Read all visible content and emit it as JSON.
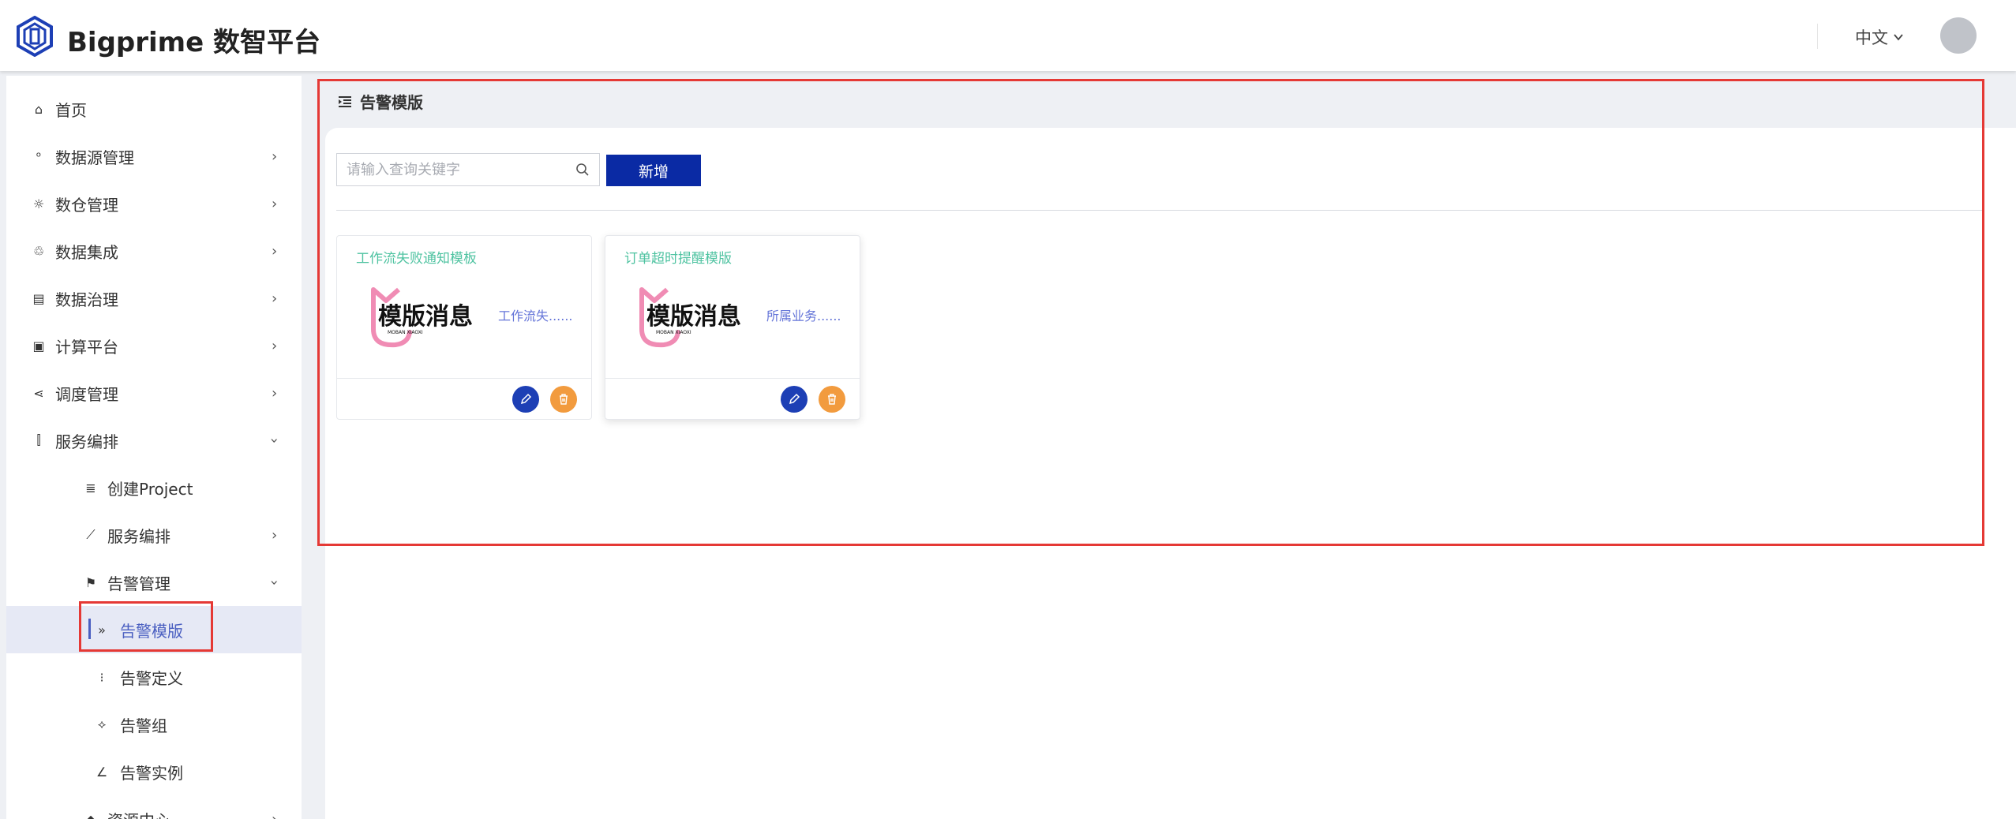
{
  "header": {
    "app_title": "Bigprime 数智平台",
    "language": "中文"
  },
  "sidebar": {
    "items": [
      {
        "label": "首页",
        "icon": "home-icon"
      },
      {
        "label": "数据源管理",
        "icon": "database-icon"
      },
      {
        "label": "数仓管理",
        "icon": "warehouse-icon"
      },
      {
        "label": "数据集成",
        "icon": "integration-icon"
      },
      {
        "label": "数据治理",
        "icon": "governance-icon"
      },
      {
        "label": "计算平台",
        "icon": "compute-icon"
      },
      {
        "label": "调度管理",
        "icon": "share-icon"
      },
      {
        "label": "服务编排",
        "icon": "bar-chart-icon"
      },
      {
        "label": "创建Project",
        "icon": "list-icon"
      },
      {
        "label": "服务编排",
        "icon": "line-chart-icon"
      },
      {
        "label": "告警管理",
        "icon": "flag-icon"
      },
      {
        "label": "告警模版",
        "icon": "double-chevron-icon"
      },
      {
        "label": "告警定义",
        "icon": "list-icon"
      },
      {
        "label": "告警组",
        "icon": "puzzle-icon"
      },
      {
        "label": "告警实例",
        "icon": "pen-icon"
      },
      {
        "label": "资源中心",
        "icon": "resource-icon"
      }
    ]
  },
  "main": {
    "title": "告警模版",
    "search_placeholder": "请输入查询关键字",
    "add_button": "新增",
    "cards": [
      {
        "title": "工作流失败通知模板",
        "description": "工作流失......"
      },
      {
        "title": "订单超时提醒模版",
        "description": "所属业务......"
      }
    ],
    "card_image": {
      "text": "模版消息",
      "subtext": "MOBAN XIAOXI"
    }
  },
  "colors": {
    "primary": "#0a2aa4",
    "card_title": "#4fc3a1",
    "card_desc": "#6474d8",
    "delete": "#f29b3e",
    "highlight": "#e53935"
  }
}
